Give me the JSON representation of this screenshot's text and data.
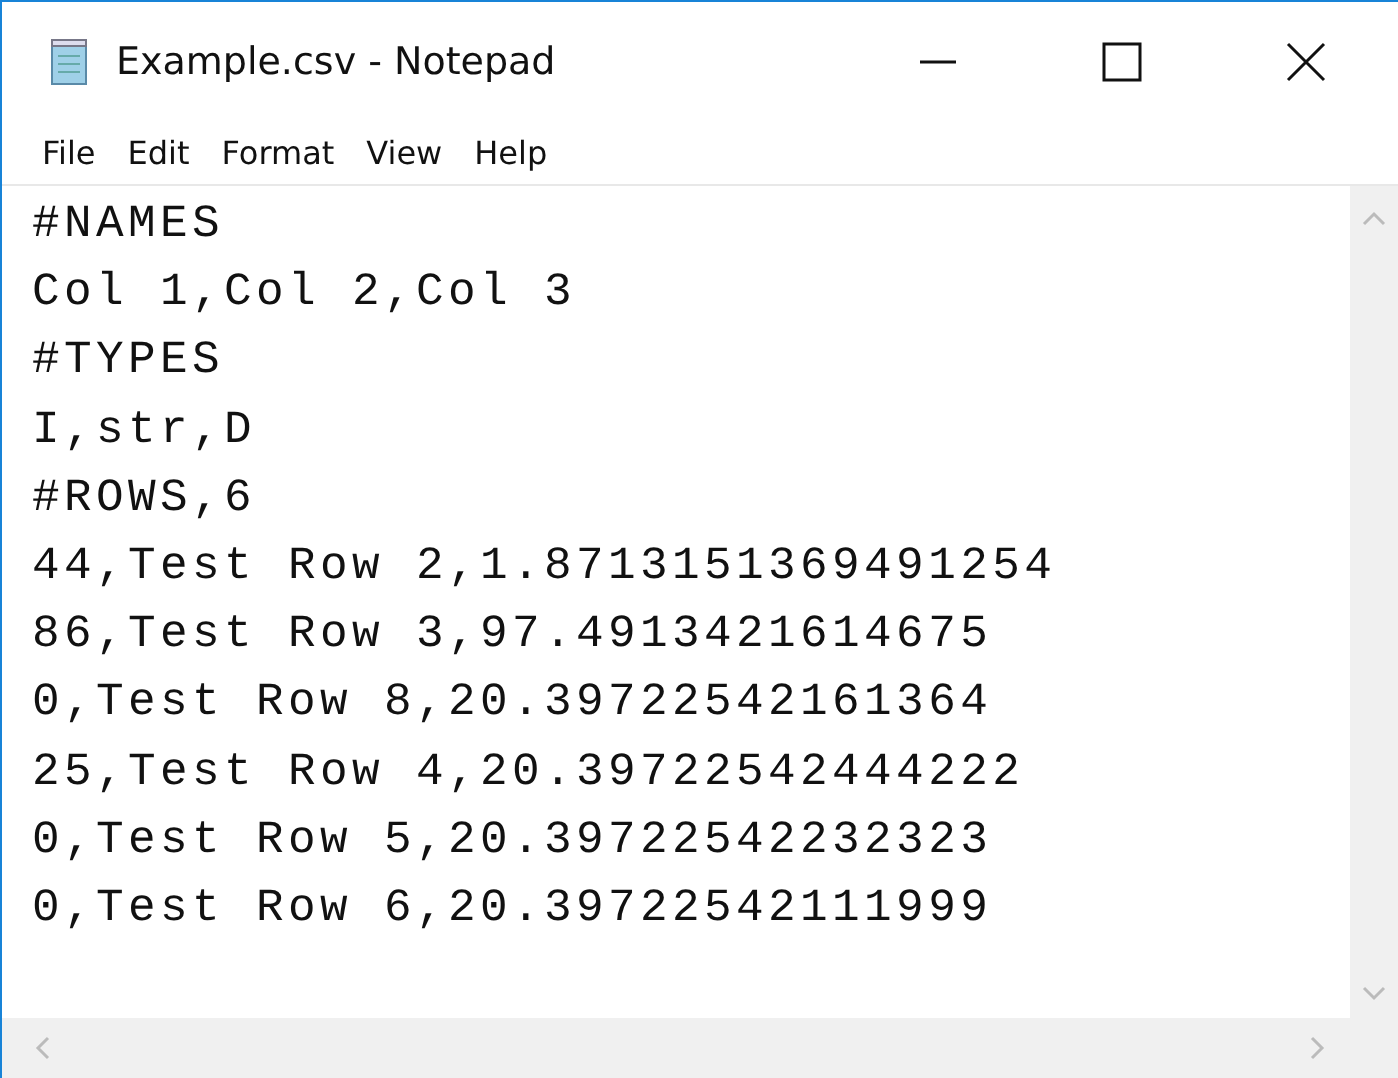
{
  "window": {
    "title": "Example.csv - Notepad"
  },
  "menu": [
    "File",
    "Edit",
    "Format",
    "View",
    "Help"
  ],
  "editor": {
    "lines": [
      "#NAMES",
      "Col 1,Col 2,Col 3",
      "#TYPES",
      "I,str,D",
      "#ROWS,6",
      "44,Test Row 2,1.8713151369491254",
      "86,Test Row 3,97.4913421614675",
      "0,Test Row 8,20.39722542161364",
      "25,Test Row 4,20.39722542444222",
      "0,Test Row 5,20.39722542232323",
      "0,Test Row 6,20.39722542111999"
    ]
  }
}
